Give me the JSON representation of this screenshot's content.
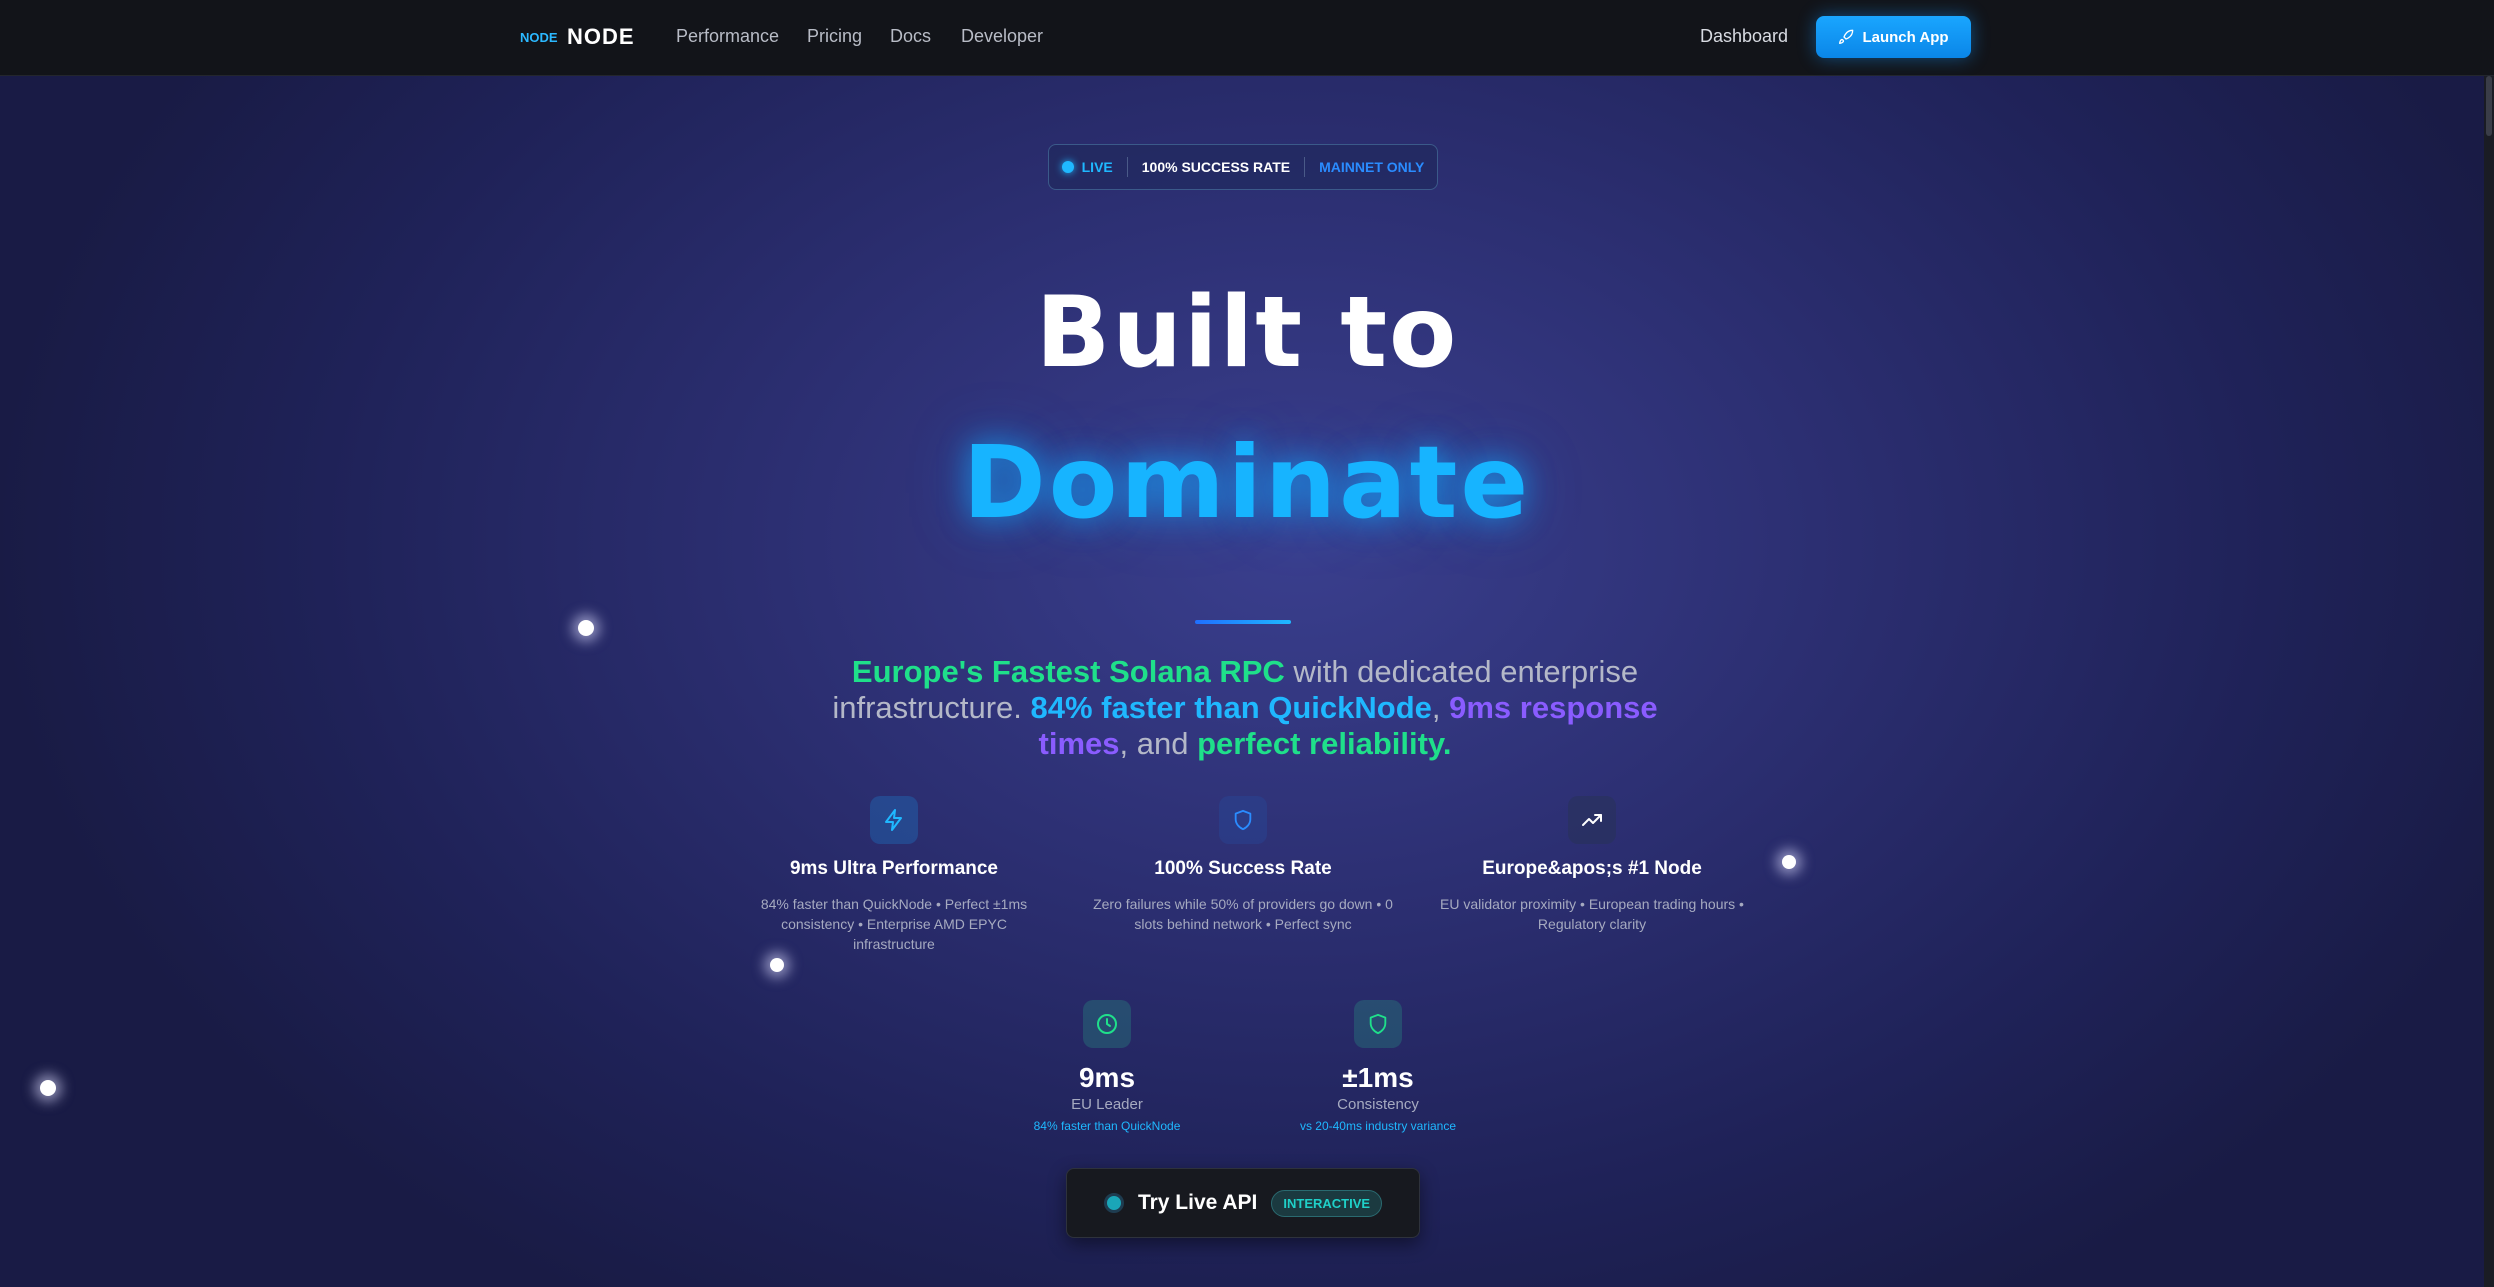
{
  "nav": {
    "logo_small": "NODE",
    "logo_big": "NODE",
    "links": [
      "Performance",
      "Pricing",
      "Docs",
      "Developer"
    ],
    "dashboard": "Dashboard",
    "launch": "Launch App"
  },
  "badge": {
    "live": "LIVE",
    "success": "100% SUCCESS RATE",
    "mainnet": "MAINNET ONLY"
  },
  "hero": {
    "line1": "Built to",
    "line2": "Dominate"
  },
  "subtitle": {
    "part1": "Europe's Fastest Solana RPC",
    "part2": " with dedicated enterprise infrastructure. ",
    "part3": "84% faster than QuickNode",
    "part4": ", ",
    "part5": "9ms response times",
    "part6": ", and ",
    "part7": "perfect reliability",
    "part8": "."
  },
  "features": [
    {
      "icon": "lightning-icon",
      "title": "9ms Ultra Performance",
      "desc": "84% faster than QuickNode • Perfect ±1ms consistency • Enterprise AMD EPYC infrastructure"
    },
    {
      "icon": "shield-icon",
      "title": "100% Success Rate",
      "desc": "Zero failures while 50% of providers go down • 0 slots behind network • Perfect sync"
    },
    {
      "icon": "trending-up-icon",
      "title": "Europe&apos;s #1 Node",
      "desc": "EU validator proximity • European trading hours • Regulatory clarity"
    }
  ],
  "stats": [
    {
      "icon": "clock-icon",
      "value": "9ms",
      "label": "EU Leader",
      "note": "84% faster than QuickNode"
    },
    {
      "icon": "shield-icon",
      "value": "±1ms",
      "label": "Consistency",
      "note": "vs 20-40ms industry variance"
    }
  ],
  "try_api": {
    "label": "Try Live API",
    "tag": "INTERACTIVE"
  },
  "colors": {
    "accent_blue": "#17b4ff",
    "accent_green": "#1fe08a",
    "accent_purple": "#8a5cff"
  }
}
